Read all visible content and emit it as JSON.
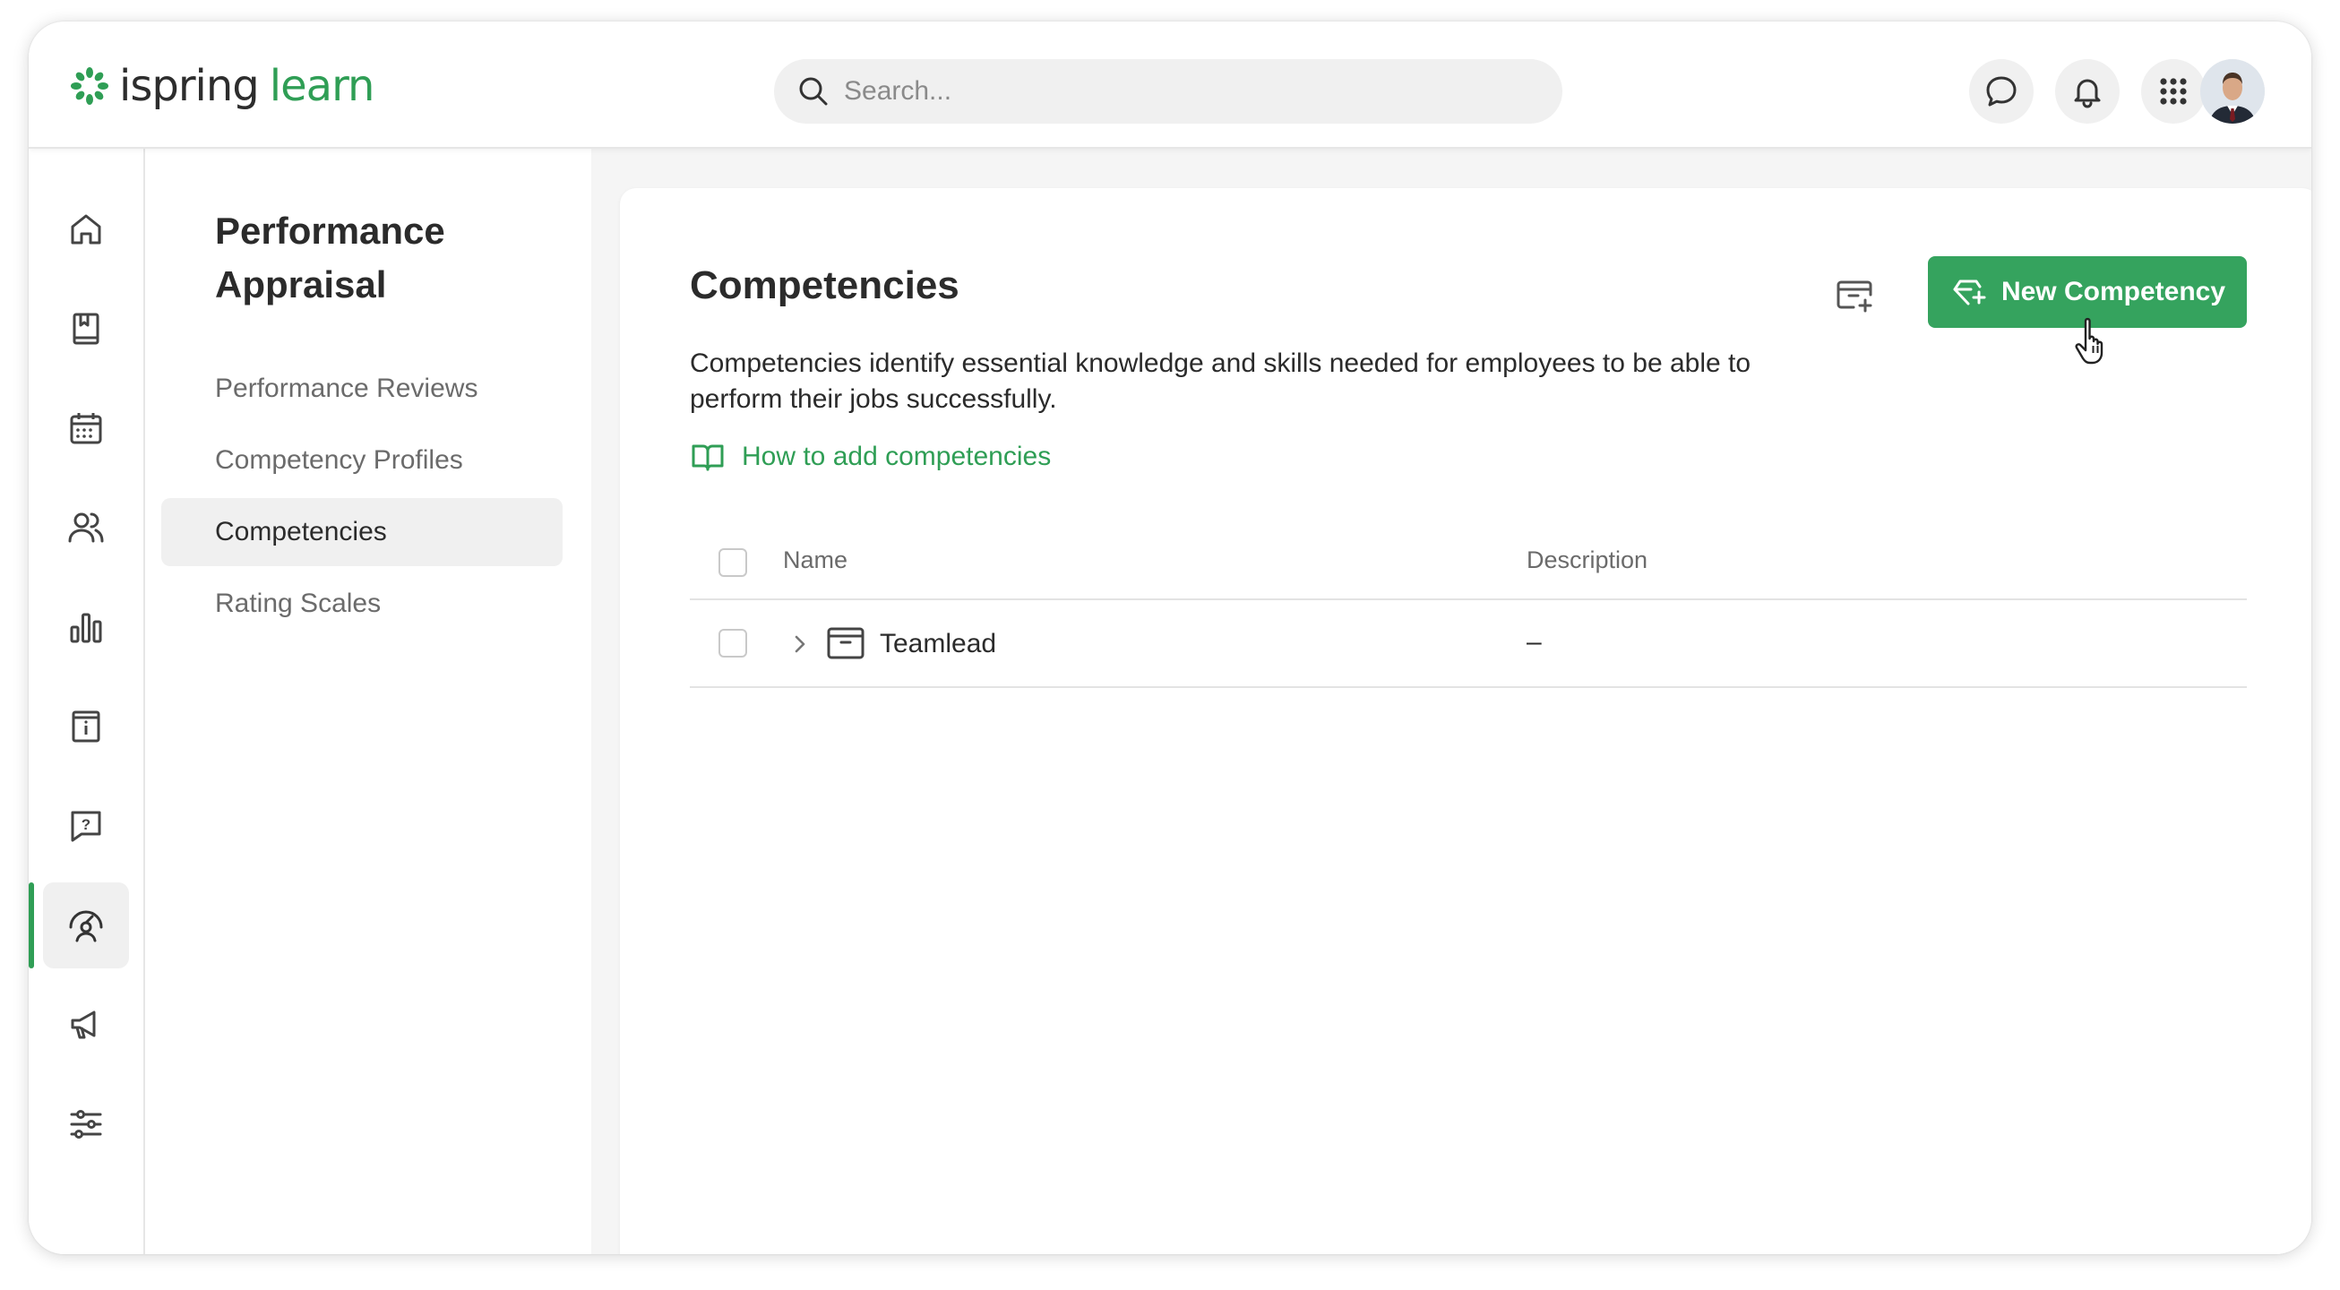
{
  "brand": {
    "logo_word1": "ispring",
    "logo_word2": "learn",
    "accent_color": "#2f9e55"
  },
  "search": {
    "placeholder": "Search..."
  },
  "header_icons": [
    "chat-icon",
    "bell-icon",
    "apps-grid-icon",
    "user-avatar"
  ],
  "rail": {
    "items": [
      {
        "icon": "home-icon"
      },
      {
        "icon": "book-icon"
      },
      {
        "icon": "calendar-icon"
      },
      {
        "icon": "users-icon"
      },
      {
        "icon": "reports-icon"
      },
      {
        "icon": "info-icon"
      },
      {
        "icon": "question-icon"
      },
      {
        "icon": "performance-icon",
        "active": true
      },
      {
        "icon": "megaphone-icon"
      },
      {
        "icon": "settings-sliders-icon"
      }
    ]
  },
  "section": {
    "title": "Performance Appraisal",
    "items": [
      {
        "label": "Performance Reviews"
      },
      {
        "label": "Competency Profiles"
      },
      {
        "label": "Competencies",
        "active": true
      },
      {
        "label": "Rating Scales"
      }
    ]
  },
  "main": {
    "title": "Competencies",
    "description": "Competencies identify essential knowledge and skills needed for employees to be able to perform their jobs successfully.",
    "help_link": "How to add competencies",
    "new_button": "New Competency",
    "table": {
      "columns": [
        "Name",
        "Description"
      ],
      "rows": [
        {
          "name": "Teamlead",
          "description": "–"
        }
      ]
    }
  }
}
